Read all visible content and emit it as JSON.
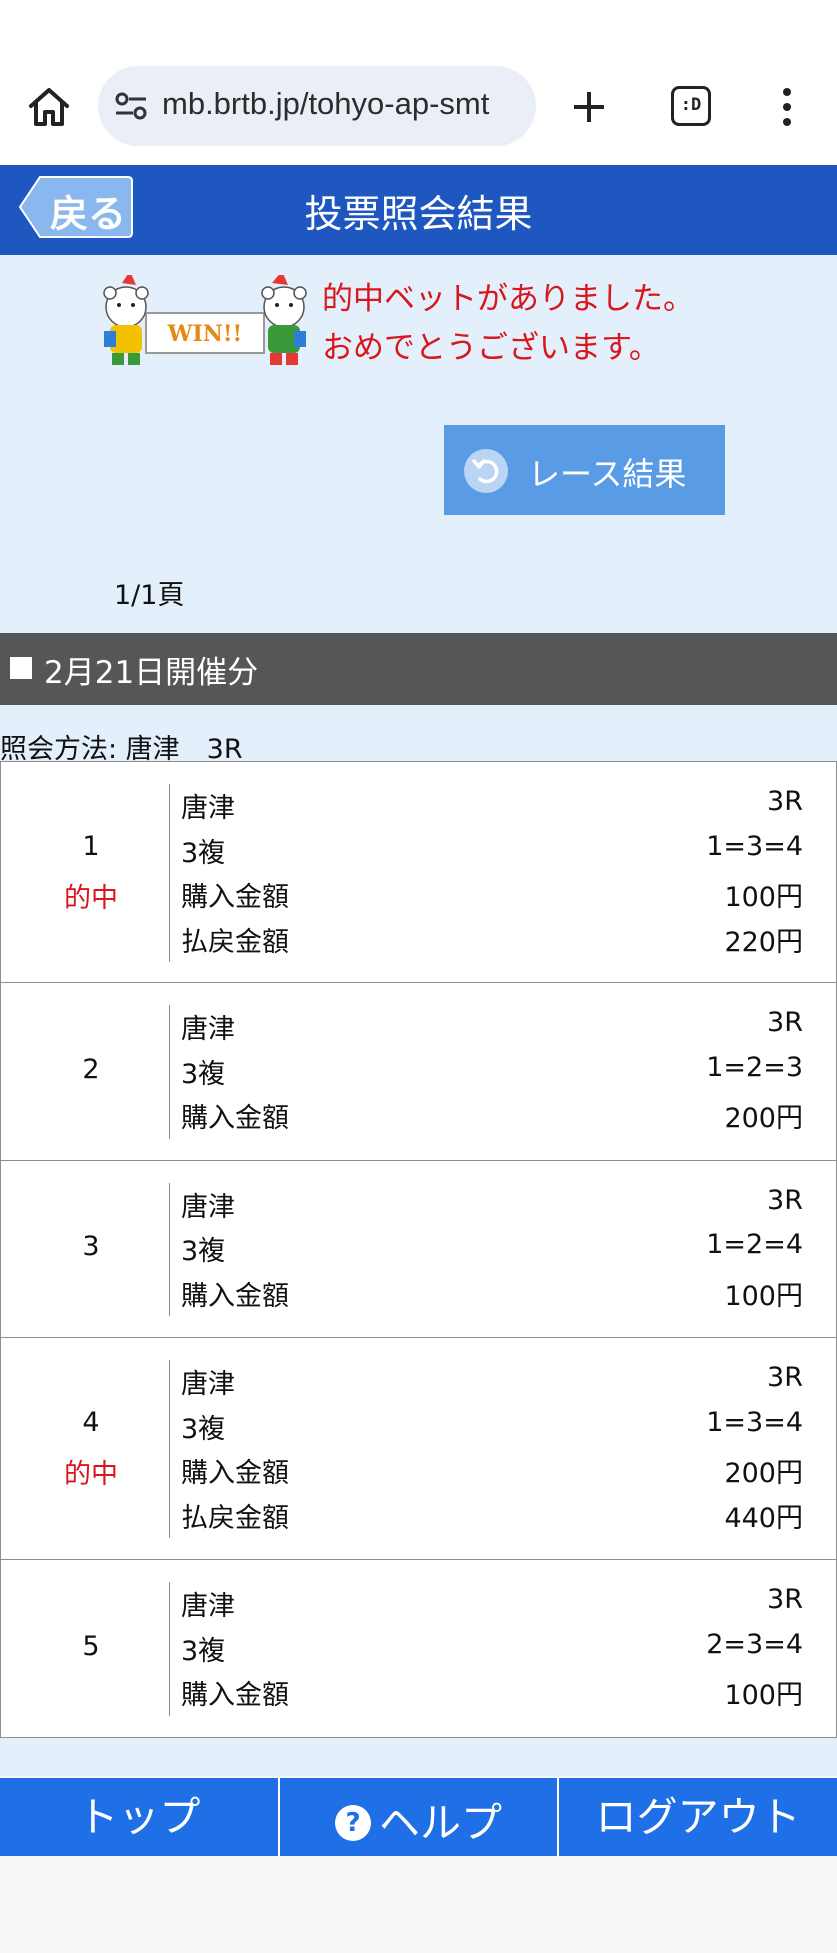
{
  "browser": {
    "url": "mb.brtb.jp/tohyo-ap-smt",
    "tabs_label": ":D"
  },
  "header": {
    "back_label": "戻る",
    "title": "投票照会結果"
  },
  "notice": {
    "win_badge": "WIN!!",
    "message_line1": "的中ベットがありました。",
    "message_line2": "おめでとうございます。",
    "race_result_label": "レース結果",
    "page_indicator": "1/1頁"
  },
  "date_bar": {
    "label": "2月21日開催分"
  },
  "query": {
    "label": "照会方法: 唐津　3R"
  },
  "bets": [
    {
      "no": "1",
      "hit": "的中",
      "lines": [
        {
          "k": "唐津",
          "v": "3R"
        },
        {
          "k": "3複",
          "v": "1=3=4"
        },
        {
          "k": "購入金額",
          "v": "100円"
        },
        {
          "k": "払戻金額",
          "v": "220円"
        }
      ]
    },
    {
      "no": "2",
      "hit": "",
      "lines": [
        {
          "k": "唐津",
          "v": "3R"
        },
        {
          "k": "3複",
          "v": "1=2=3"
        },
        {
          "k": "購入金額",
          "v": "200円"
        }
      ]
    },
    {
      "no": "3",
      "hit": "",
      "lines": [
        {
          "k": "唐津",
          "v": "3R"
        },
        {
          "k": "3複",
          "v": "1=2=4"
        },
        {
          "k": "購入金額",
          "v": "100円"
        }
      ]
    },
    {
      "no": "4",
      "hit": "的中",
      "lines": [
        {
          "k": "唐津",
          "v": "3R"
        },
        {
          "k": "3複",
          "v": "1=3=4"
        },
        {
          "k": "購入金額",
          "v": "200円"
        },
        {
          "k": "払戻金額",
          "v": "440円"
        }
      ]
    },
    {
      "no": "5",
      "hit": "",
      "lines": [
        {
          "k": "唐津",
          "v": "3R"
        },
        {
          "k": "3複",
          "v": "2=3=4"
        },
        {
          "k": "購入金額",
          "v": "100円"
        }
      ]
    }
  ],
  "bottom_nav": {
    "top": "トップ",
    "help": "ヘルプ",
    "logout": "ログアウト"
  },
  "colors": {
    "header_blue": "#1f57c1",
    "nav_blue": "#1f6fe6",
    "hit_red": "#d8171d",
    "light_bg": "#e3f0fb",
    "date_bar": "#565656"
  }
}
